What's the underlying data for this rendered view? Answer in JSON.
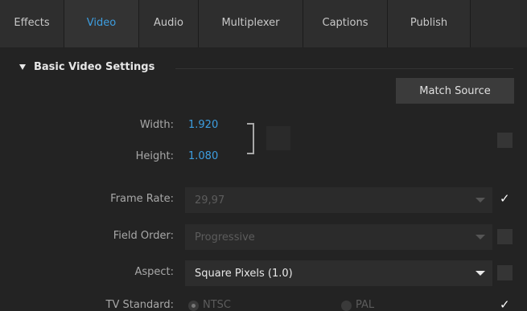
{
  "tabs": [
    {
      "label": "Effects",
      "active": false
    },
    {
      "label": "Video",
      "active": true
    },
    {
      "label": "Audio",
      "active": false
    },
    {
      "label": "Multiplexer",
      "active": false
    },
    {
      "label": "Captions",
      "active": false
    },
    {
      "label": "Publish",
      "active": false
    }
  ],
  "section": {
    "title": "Basic Video Settings",
    "match_source_label": "Match Source"
  },
  "width": {
    "label": "Width:",
    "value": "1.920"
  },
  "height": {
    "label": "Height:",
    "value": "1.080"
  },
  "frame_rate": {
    "label": "Frame Rate:",
    "value": "29,97",
    "checked": true
  },
  "field_order": {
    "label": "Field Order:",
    "value": "Progressive",
    "checked": false
  },
  "aspect": {
    "label": "Aspect:",
    "value": "Square Pixels (1.0)",
    "checked": false
  },
  "tv_standard": {
    "label": "TV Standard:",
    "options": [
      "NTSC",
      "PAL"
    ],
    "selected": "NTSC",
    "checked": true
  },
  "glyphs": {
    "check": "✓"
  },
  "colors": {
    "accent": "#3d9ee0",
    "background": "#232323"
  }
}
